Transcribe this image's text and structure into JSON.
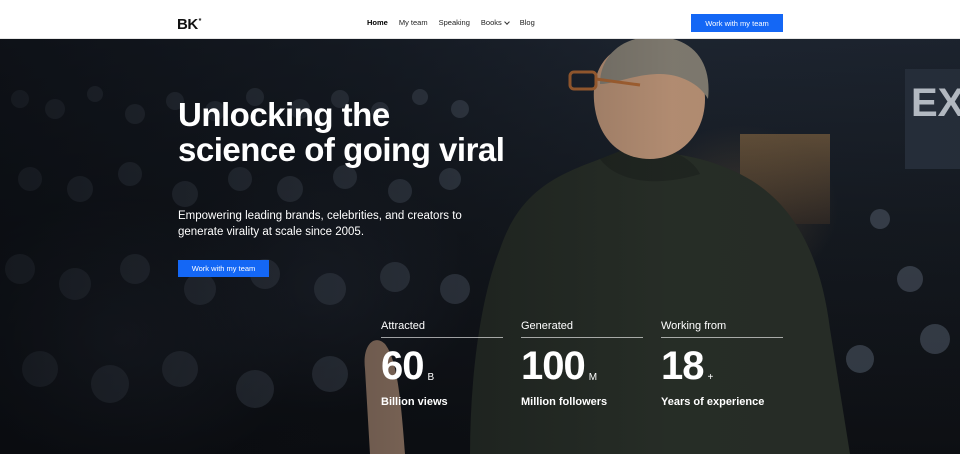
{
  "header": {
    "logo": "BK",
    "logo_mark": "*",
    "nav": [
      "Home",
      "My team",
      "Speaking",
      "Books",
      "Blog"
    ],
    "active_nav": "Home",
    "cta_label": "Work with my team"
  },
  "hero": {
    "title": "Unlocking the science of going viral",
    "subtitle": "Empowering leading brands, celebrities, and creators to generate virality at scale since 2005.",
    "cta_label": "Work with my team",
    "background_sign": "EX",
    "stats": [
      {
        "label": "Attracted",
        "value": "60",
        "unit": "B",
        "caption": "Billion views"
      },
      {
        "label": "Generated",
        "value": "100",
        "unit": "M",
        "caption": "Million followers"
      },
      {
        "label": "Working from",
        "value": "18",
        "unit": "+",
        "caption": "Years of experience"
      }
    ]
  },
  "colors": {
    "accent": "#1467f5",
    "header_bg": "#ffffff",
    "hero_text": "#ffffff"
  }
}
